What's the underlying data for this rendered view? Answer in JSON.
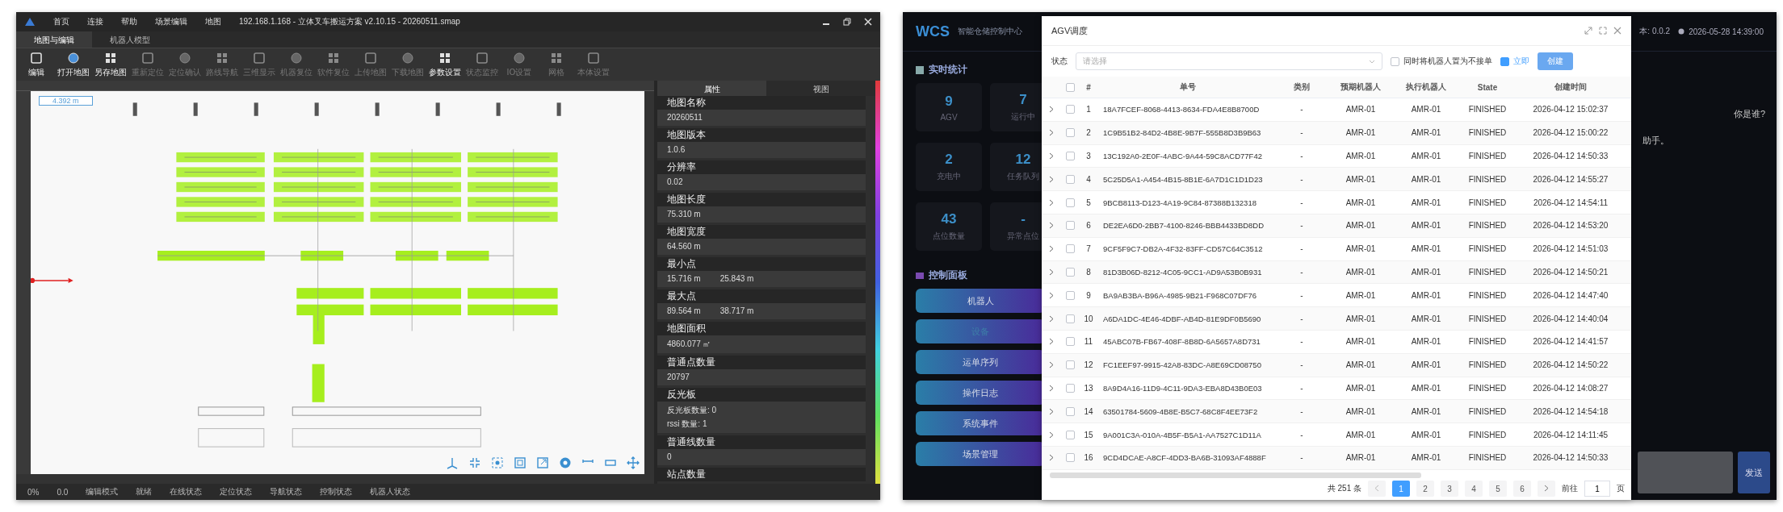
{
  "map_editor": {
    "menu": [
      "首页",
      "连接",
      "帮助",
      "场景编辑",
      "地图"
    ],
    "title": "192.168.1.168 - 立体叉车搬运方案 v2.10.15 - 20260511.smap",
    "tabs": [
      {
        "label": "地图与编辑",
        "selected": true
      },
      {
        "label": "机器人模型",
        "selected": false
      }
    ],
    "toolbar": [
      {
        "label": "编辑",
        "disabled": false
      },
      {
        "label": "打开地图",
        "disabled": false
      },
      {
        "label": "另存地图",
        "disabled": false
      },
      {
        "label": "重新定位",
        "disabled": true
      },
      {
        "label": "定位确认",
        "disabled": true
      },
      {
        "label": "路线导航",
        "disabled": true
      },
      {
        "label": "三维显示",
        "disabled": true
      },
      {
        "label": "机器复位",
        "disabled": true
      },
      {
        "label": "软件复位",
        "disabled": true
      },
      {
        "label": "上传地图",
        "disabled": true
      },
      {
        "label": "下载地图",
        "disabled": true
      },
      {
        "label": "参数设置",
        "disabled": false
      },
      {
        "label": "状态监控",
        "disabled": true
      },
      {
        "label": "IO设置",
        "disabled": true
      },
      {
        "label": "网格",
        "disabled": true
      },
      {
        "label": "本体设置",
        "disabled": true
      }
    ],
    "scale_label": "4.392 m",
    "panel_tabs": [
      {
        "label": "属性",
        "selected": true
      },
      {
        "label": "视图",
        "selected": false
      }
    ],
    "properties": [
      {
        "label": "地图名称",
        "kind": "single",
        "values": [
          "20260511"
        ]
      },
      {
        "label": "地图版本",
        "kind": "single",
        "values": [
          "1.0.6"
        ]
      },
      {
        "label": "分辨率",
        "kind": "single",
        "values": [
          "0.02"
        ]
      },
      {
        "label": "地图长度",
        "kind": "single",
        "values": [
          "75.310 m"
        ]
      },
      {
        "label": "地图宽度",
        "kind": "single",
        "values": [
          "64.560 m"
        ]
      },
      {
        "label": "最小点",
        "kind": "pair",
        "values": [
          "15.716 m",
          "25.843 m"
        ]
      },
      {
        "label": "最大点",
        "kind": "pair",
        "values": [
          "89.564 m",
          "38.717 m"
        ]
      },
      {
        "label": "地图面积",
        "kind": "single",
        "values": [
          "4860.077 ㎡"
        ]
      },
      {
        "label": "普通点数量",
        "kind": "single",
        "values": [
          "20797"
        ]
      },
      {
        "label": "反光板",
        "kind": "lines",
        "values": [
          "反光板数量:  0",
          "rssi 数量:  1"
        ]
      },
      {
        "label": "普通线数量",
        "kind": "single",
        "values": [
          "0"
        ]
      },
      {
        "label": "站点数量"
      }
    ],
    "status_bar": [
      "0%",
      "0.0",
      "编辑模式",
      "就绪",
      "在线状态",
      "定位状态",
      "导航状态",
      "控制状态",
      "机器人状态"
    ]
  },
  "wcs": {
    "logo": "WCS",
    "subtitle": "智能仓储控制中心",
    "version": "本: 0.0.2",
    "clock": "2026-05-28 14:39:00",
    "stats_title": "实时统计",
    "stats": [
      {
        "value": "9",
        "label": "AGV"
      },
      {
        "value": "7",
        "label": "运行中"
      },
      {
        "value": "2",
        "label": "充电中"
      },
      {
        "value": "12",
        "label": "任务队列"
      },
      {
        "value": "43",
        "label": "点位数量"
      },
      {
        "value": "-",
        "label": "异常点位"
      }
    ],
    "controls_title": "控制面板",
    "controls": [
      {
        "label": "机器人",
        "disabled": false
      },
      {
        "label": "设备",
        "disabled": true
      },
      {
        "label": "运单序列",
        "disabled": false
      },
      {
        "label": "操作日志",
        "disabled": false
      },
      {
        "label": "系统事件",
        "disabled": false
      },
      {
        "label": "场景管理",
        "disabled": false
      }
    ],
    "chat": {
      "messages": [
        {
          "kind": "user",
          "text": "你是谁?"
        },
        {
          "kind": "assistant",
          "text": "助手。"
        }
      ],
      "send": "发送"
    }
  },
  "agv_dialog": {
    "title": "AGV调度",
    "filter_label": "状态",
    "filter_placeholder": "请选择",
    "options": [
      {
        "label": "同时将机器人置为不接单",
        "checked": false
      },
      {
        "label": "立即",
        "checked": true
      }
    ],
    "create": "创建",
    "select_all": {
      "checked": false
    },
    "columns": [
      "#",
      "单号",
      "类别",
      "预期机器人",
      "执行机器人",
      "State",
      "创建时间"
    ],
    "rows": [
      {
        "index": "1",
        "id": "18A7FCEF-8068-4413-8634-FDA4E8B8700D",
        "category": "-",
        "expected": "AMR-01",
        "executor": "AMR-01",
        "state": "FINISHED",
        "created": "2026-04-12 15:02:37",
        "checked": false
      },
      {
        "index": "2",
        "id": "1C9B51B2-84D2-4B8E-9B7F-555B8D3B9B63",
        "category": "-",
        "expected": "AMR-01",
        "executor": "AMR-01",
        "state": "FINISHED",
        "created": "2026-04-12 15:00:22",
        "checked": false
      },
      {
        "index": "3",
        "id": "13C192A0-2E0F-4ABC-9A44-59C8ACD77F42",
        "category": "-",
        "expected": "AMR-01",
        "executor": "AMR-01",
        "state": "FINISHED",
        "created": "2026-04-12 14:50:33",
        "checked": false
      },
      {
        "index": "4",
        "id": "5C25D5A1-A454-4B15-8B1E-6A7D1C1D1D23",
        "category": "-",
        "expected": "AMR-01",
        "executor": "AMR-01",
        "state": "FINISHED",
        "created": "2026-04-12 14:55:27",
        "checked": false
      },
      {
        "index": "5",
        "id": "9BCB8113-D123-4A19-9C84-87388B132318",
        "category": "-",
        "expected": "AMR-01",
        "executor": "AMR-01",
        "state": "FINISHED",
        "created": "2026-04-12 14:54:11",
        "checked": false
      },
      {
        "index": "6",
        "id": "DE2EA6D0-2BB7-4100-8246-BBB4433BD8DD",
        "category": "-",
        "expected": "AMR-01",
        "executor": "AMR-01",
        "state": "FINISHED",
        "created": "2026-04-12 14:53:20",
        "checked": false
      },
      {
        "index": "7",
        "id": "9CF5F9C7-DB2A-4F32-83FF-CD57C64C3512",
        "category": "-",
        "expected": "AMR-01",
        "executor": "AMR-01",
        "state": "FINISHED",
        "created": "2026-04-12 14:51:03",
        "checked": false
      },
      {
        "index": "8",
        "id": "81D3B06D-8212-4C05-9CC1-AD9A53B0B931",
        "category": "-",
        "expected": "AMR-01",
        "executor": "AMR-01",
        "state": "FINISHED",
        "created": "2026-04-12 14:50:21",
        "checked": false
      },
      {
        "index": "9",
        "id": "BA9AB3BA-B96A-4985-9B21-F968C07DF76",
        "category": "-",
        "expected": "AMR-01",
        "executor": "AMR-01",
        "state": "FINISHED",
        "created": "2026-04-12 14:47:40",
        "checked": false
      },
      {
        "index": "10",
        "id": "A6DA1DC-4E46-4DBF-AB4D-81E9DF0B5690",
        "category": "-",
        "expected": "AMR-01",
        "executor": "AMR-01",
        "state": "FINISHED",
        "created": "2026-04-12 14:40:04",
        "checked": false
      },
      {
        "index": "11",
        "id": "45ABC07B-FB67-408F-8B8D-6A5657A8D731",
        "category": "-",
        "expected": "AMR-01",
        "executor": "AMR-01",
        "state": "FINISHED",
        "created": "2026-04-12 14:41:57",
        "checked": false
      },
      {
        "index": "12",
        "id": "FC1EEF97-9915-42A8-83DC-A8E69CD08750",
        "category": "-",
        "expected": "AMR-01",
        "executor": "AMR-01",
        "state": "FINISHED",
        "created": "2026-04-12 14:50:22",
        "checked": false
      },
      {
        "index": "13",
        "id": "8A9D4A16-11D9-4C11-9DA3-EBA8D43B0E03",
        "category": "-",
        "expected": "AMR-01",
        "executor": "AMR-01",
        "state": "FINISHED",
        "created": "2026-04-12 14:08:27",
        "checked": false
      },
      {
        "index": "14",
        "id": "63501784-5609-4B8E-B5C7-68C8F4EE73F2",
        "category": "-",
        "expected": "AMR-01",
        "executor": "AMR-01",
        "state": "FINISHED",
        "created": "2026-04-12 14:54:18",
        "checked": false
      },
      {
        "index": "15",
        "id": "9A001C3A-010A-4B5F-B5A1-AA7527C1D11A",
        "category": "-",
        "expected": "AMR-01",
        "executor": "AMR-01",
        "state": "FINISHED",
        "created": "2026-04-12 14:11:45",
        "checked": false
      },
      {
        "index": "16",
        "id": "9CD4DCAE-A8CF-4DD3-BA6B-31093AF4888F",
        "category": "-",
        "expected": "AMR-01",
        "executor": "AMR-01",
        "state": "FINISHED",
        "created": "2026-04-12 14:50:33",
        "checked": false
      }
    ],
    "total": "共 251 条",
    "pages": [
      {
        "label": "1",
        "selected": true
      },
      {
        "label": "2",
        "selected": false
      },
      {
        "label": "3",
        "selected": false
      },
      {
        "label": "4",
        "selected": false
      },
      {
        "label": "5",
        "selected": false
      },
      {
        "label": "6",
        "selected": false
      }
    ],
    "goto_label": "前往",
    "goto_value": "1",
    "page_unit": "页"
  }
}
